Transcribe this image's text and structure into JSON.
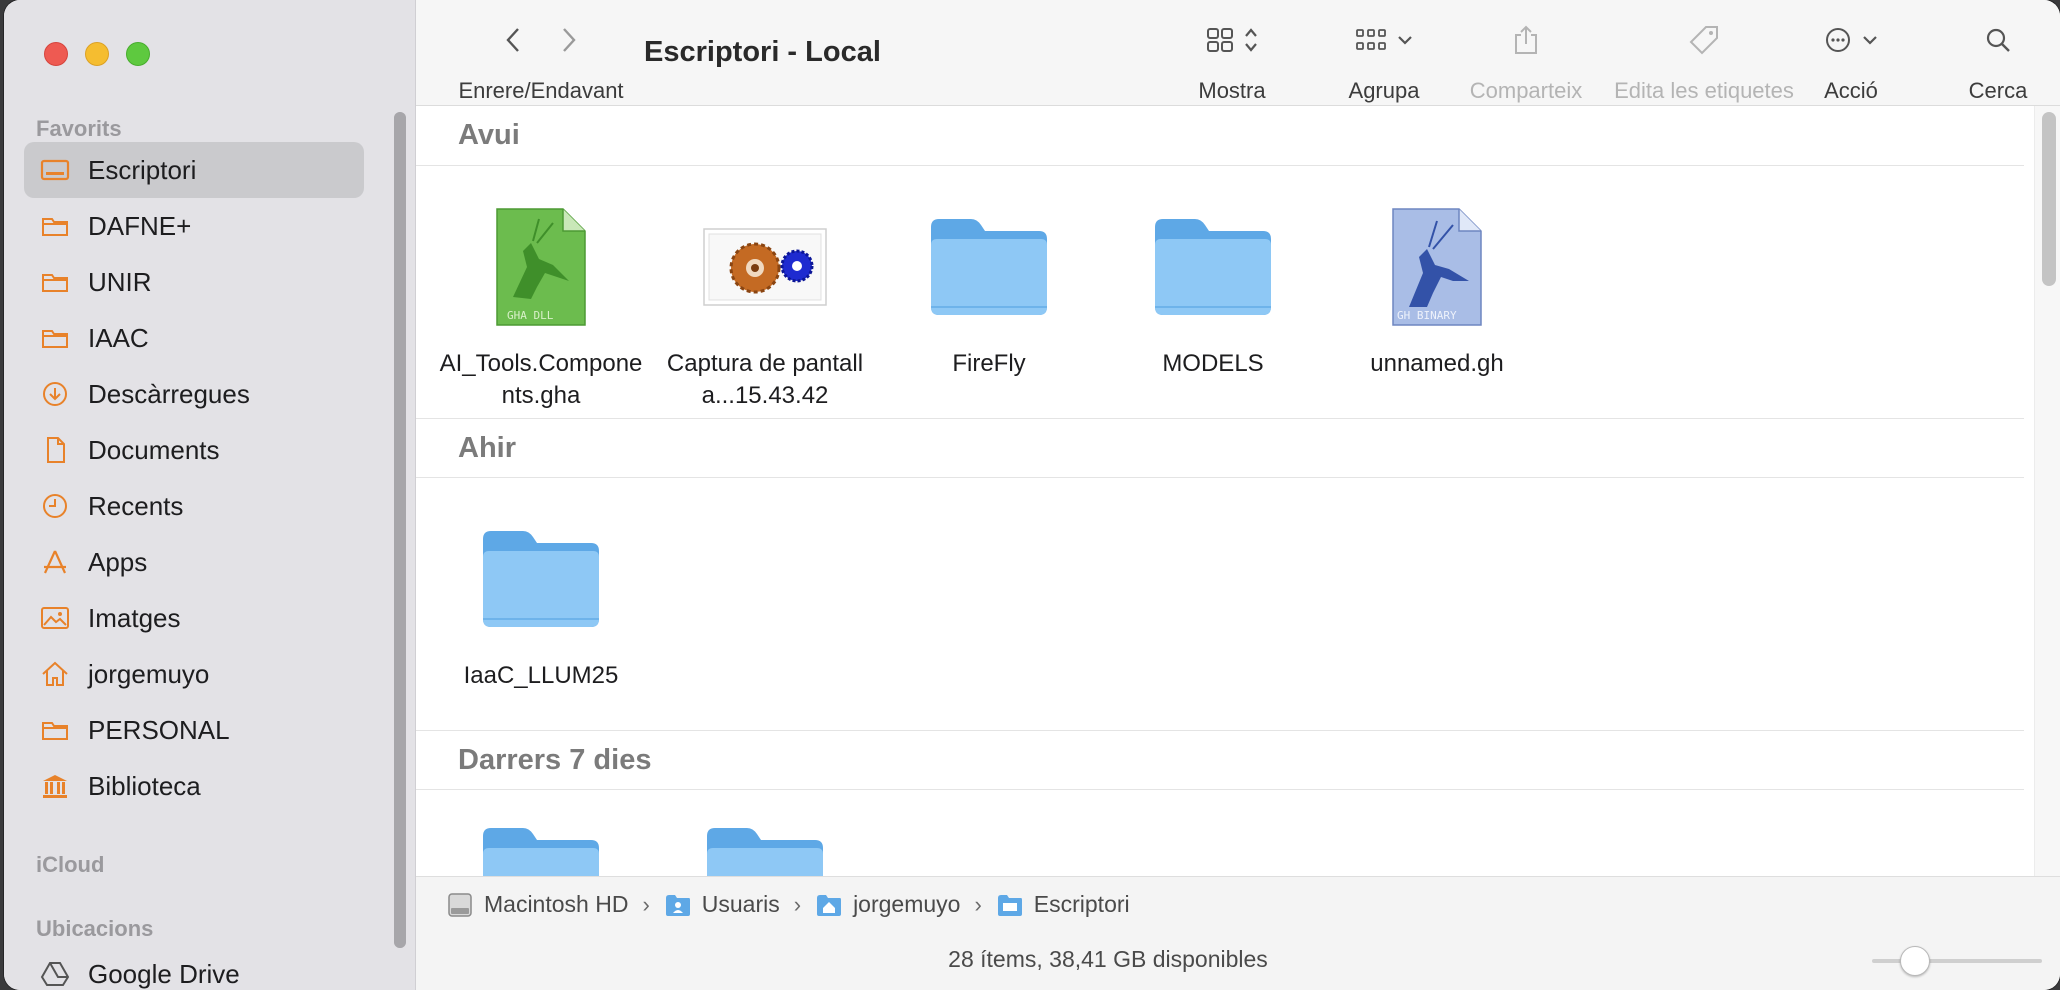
{
  "window": {
    "title": "Escriptori - Local"
  },
  "sidebar": {
    "favorites_heading": "Favorits",
    "items": [
      {
        "label": "Escriptori",
        "icon": "desktop-icon",
        "active": true
      },
      {
        "label": "DAFNE+",
        "icon": "folder-icon"
      },
      {
        "label": "UNIR",
        "icon": "folder-icon"
      },
      {
        "label": "IAAC",
        "icon": "folder-icon"
      },
      {
        "label": "Descàrregues",
        "icon": "download-icon"
      },
      {
        "label": "Documents",
        "icon": "document-icon"
      },
      {
        "label": "Recents",
        "icon": "clock-icon"
      },
      {
        "label": "Apps",
        "icon": "apps-icon"
      },
      {
        "label": "Imatges",
        "icon": "photo-icon"
      },
      {
        "label": "jorgemuyo",
        "icon": "home-icon"
      },
      {
        "label": "PERSONAL",
        "icon": "folder-icon"
      },
      {
        "label": "Biblioteca",
        "icon": "library-icon"
      }
    ],
    "icloud_heading": "iCloud",
    "locations_heading": "Ubicacions",
    "locations_items": [
      {
        "label": "Google Drive",
        "icon": "google-drive-icon"
      }
    ]
  },
  "toolbar": {
    "nav_label": "Enrere/Endavant",
    "view_label": "Mostra",
    "group_label": "Agrupa",
    "share_label": "Comparteix",
    "tags_label": "Edita les etiquetes",
    "action_label": "Acció",
    "search_label": "Cerca"
  },
  "groups": {
    "today": {
      "title": "Avui",
      "files": [
        {
          "name": "AI_Tools.Components.gha",
          "kind": "gha-file-icon"
        },
        {
          "name": "Captura de pantalla...15.43.42",
          "kind": "screenshot-thumbnail"
        },
        {
          "name": "FireFly",
          "kind": "folder-icon"
        },
        {
          "name": "MODELS",
          "kind": "folder-icon"
        },
        {
          "name": "unnamed.gh",
          "kind": "gh-file-icon"
        }
      ]
    },
    "yesterday": {
      "title": "Ahir",
      "files": [
        {
          "name": "IaaC_LLUM25",
          "kind": "folder-icon"
        }
      ]
    },
    "last7": {
      "title": "Darrers 7 dies"
    }
  },
  "pathbar": {
    "crumbs": [
      "Macintosh HD",
      "Usuaris",
      "jorgemuyo",
      "Escriptori"
    ]
  },
  "status": {
    "text": "28 ítems, 38,41 GB disponibles"
  },
  "colors": {
    "accent": "#e8822a",
    "folder_blue": "#5ea8e6",
    "sidebar_bg": "#e3e2e6",
    "active_item": "#cacacd"
  }
}
